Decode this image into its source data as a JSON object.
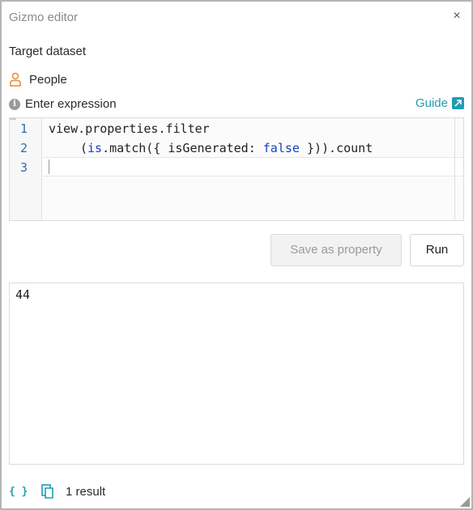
{
  "window": {
    "title": "Gizmo editor",
    "close_glyph": "×"
  },
  "target": {
    "label": "Target dataset",
    "dataset": "People",
    "icon": "person-icon",
    "icon_color": "#e88a3a"
  },
  "expression": {
    "label": "Enter expression",
    "info_glyph": "i",
    "guide_label": "Guide",
    "lines": [
      {
        "number": "1",
        "text": "view.properties.filter"
      },
      {
        "number": "2",
        "text": "(is.match({ isGenerated: false })).count",
        "keyword": "false"
      },
      {
        "number": "3",
        "text": ""
      }
    ]
  },
  "buttons": {
    "save_label": "Save as property",
    "run_label": "Run"
  },
  "result": {
    "value": "44"
  },
  "footer": {
    "braces_glyph": "{ }",
    "count_label": "1 result"
  },
  "colors": {
    "accent": "#1f9db2",
    "keyword": "#1a3fc0",
    "line_number": "#2a6fb0"
  }
}
